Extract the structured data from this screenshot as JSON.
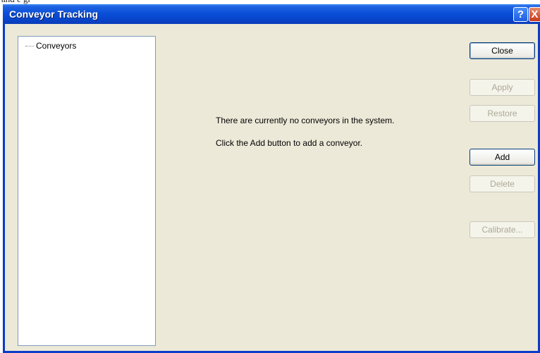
{
  "window": {
    "title": "Conveyor Tracking",
    "help_icon": "?",
    "close_icon": "X"
  },
  "tree": {
    "items": [
      {
        "label": "Conveyors"
      }
    ]
  },
  "messages": {
    "line1": "There are currently no conveyors in the system.",
    "line2": "Click the Add button to add a conveyor."
  },
  "buttons": {
    "close": "Close",
    "apply": "Apply",
    "restore": "Restore",
    "add": "Add",
    "delete": "Delete",
    "calibrate": "Calibrate..."
  }
}
